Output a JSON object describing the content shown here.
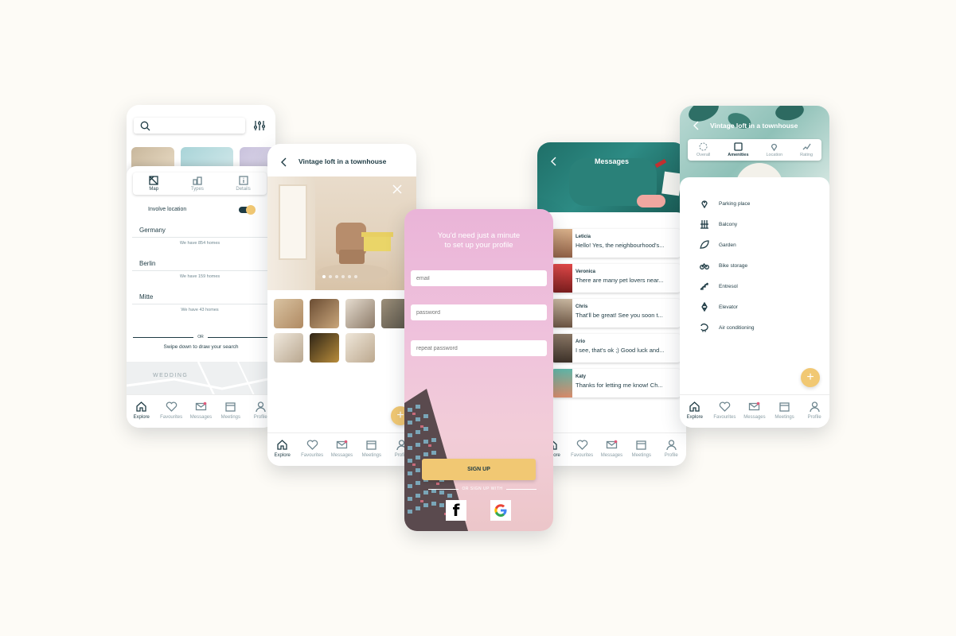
{
  "colors": {
    "background": "#fdfbf6",
    "accent": "#f1c873",
    "teal": "#2b6f6e",
    "text": "#1e3b44"
  },
  "nav": {
    "explore": "Explore",
    "favourites": "Favourites",
    "messages": "Messages",
    "meetings": "Meetings",
    "profile": "Profile"
  },
  "search_screen": {
    "tabs": {
      "map": "Map",
      "types": "Types",
      "details": "Details"
    },
    "involve_location": "Involve location",
    "locations": [
      {
        "name": "Germany",
        "count": "We have 854 homes"
      },
      {
        "name": "Berlin",
        "count": "We have 159 homes"
      },
      {
        "name": "Mitte",
        "count": "We have 43 homes"
      }
    ],
    "or": "OR",
    "swipe_hint": "Swipe down to draw your search",
    "map_label": "WEDDING"
  },
  "detail_screen": {
    "title": "Vintage loft in a townhouse",
    "fab": "+"
  },
  "signup_screen": {
    "headline_1": "You'd need just a minute",
    "headline_2": "to set up your profile",
    "email_placeholder": "email",
    "password_placeholder": "password",
    "repeat_password_placeholder": "repeat password",
    "signup_button": "SIGN UP",
    "signup_with": "OR SIGN UP WITH",
    "facebook_glyph": "f"
  },
  "messages_screen": {
    "title": "Messages",
    "threads": [
      {
        "name": "Leticia",
        "preview": "Hello! Yes, the neighbourhood's...",
        "avatar_color": "#b98a6b"
      },
      {
        "name": "Veronica",
        "preview": "There are many pet lovers near...",
        "avatar_color": "#c63a3a"
      },
      {
        "name": "Chris",
        "preview": "That'll be great! See you soon t...",
        "avatar_color": "#8b6e57"
      },
      {
        "name": "Ario",
        "preview": "I see, that's ok ;) Good luck and...",
        "avatar_color": "#6a5a4d"
      },
      {
        "name": "Katy",
        "preview": "Thanks for letting me know! Ch...",
        "avatar_color": "#d98b6a"
      }
    ]
  },
  "amenities_screen": {
    "title": "Vintage loft in a townhouse",
    "tabs": {
      "overall": "Overall",
      "amenities": "Amenities",
      "location": "Location",
      "rating": "Rating"
    },
    "items": [
      {
        "label": "Parking place",
        "icon": "pin-icon"
      },
      {
        "label": "Balcony",
        "icon": "balcony-icon"
      },
      {
        "label": "Garden",
        "icon": "leaf-icon"
      },
      {
        "label": "Bike storage",
        "icon": "bike-icon"
      },
      {
        "label": "Entresol",
        "icon": "stairs-icon"
      },
      {
        "label": "Elevator",
        "icon": "elevator-icon"
      },
      {
        "label": "Air conditioning",
        "icon": "ac-icon"
      }
    ],
    "fab": "+"
  }
}
